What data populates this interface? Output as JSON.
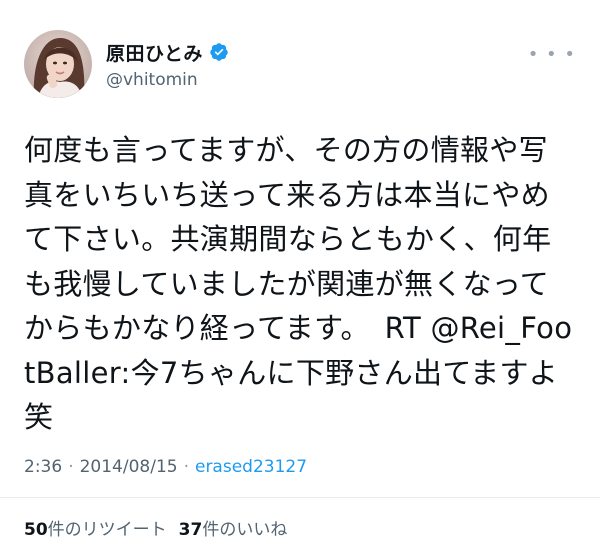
{
  "author": {
    "display_name": "原田ひとみ",
    "handle": "@vhitomin",
    "verified_icon": "verified-badge-icon",
    "accent_color": "#1d9bf0"
  },
  "more_label": "• • •",
  "tweet": {
    "text": "何度も言ってますが、その方の情報や写真をいちいち送って来る方は本当にやめて下さい。共演期間ならともかく、何年も我慢していましたが関連が無くなってからもかなり経ってます。　RT @Rei_FootBaller:今7ちゃんに下野さん出てますよ笑"
  },
  "meta": {
    "time": "2:36",
    "date": "2014/08/15",
    "separator": "·",
    "source": "erased23127"
  },
  "stats": {
    "retweets_count": "50",
    "retweets_label": "件のリツイート",
    "likes_count": "37",
    "likes_label": "件のいいね"
  }
}
